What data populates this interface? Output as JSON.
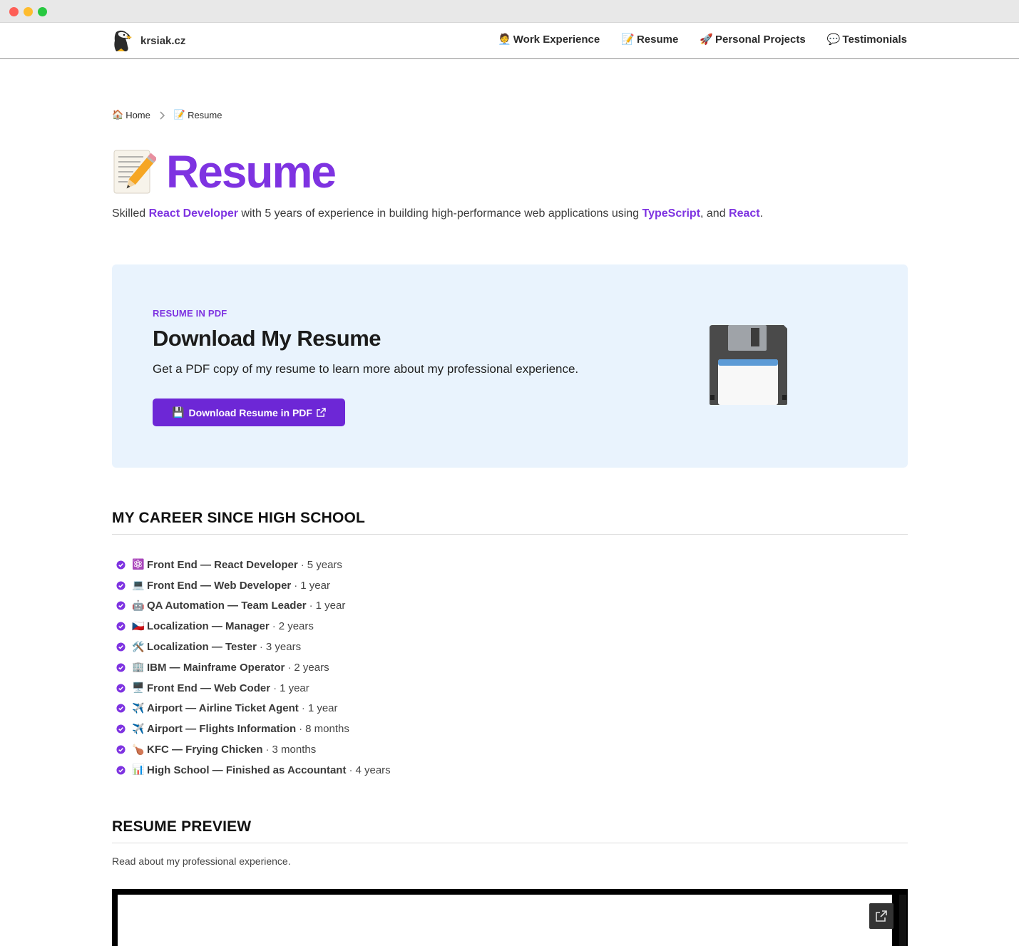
{
  "site": {
    "name": "krsiak.cz"
  },
  "nav": {
    "items": [
      {
        "icon": "🧑‍💼",
        "label": "Work Experience"
      },
      {
        "icon": "📝",
        "label": "Resume"
      },
      {
        "icon": "🚀",
        "label": "Personal Projects"
      },
      {
        "icon": "💬",
        "label": "Testimonials"
      }
    ]
  },
  "breadcrumb": {
    "home_icon": "🏠",
    "home": "Home",
    "current_icon": "📝",
    "current": "Resume"
  },
  "hero": {
    "emoji": "📝",
    "title": "Resume",
    "intro_prefix": "Skilled ",
    "intro_role": "React Developer",
    "intro_middle": " with 5 years of experience in building high-performance web applications using ",
    "intro_tech1": "TypeScript",
    "intro_between": ", and ",
    "intro_tech2": "React",
    "intro_suffix": "."
  },
  "cta": {
    "eyebrow": "RESUME IN PDF",
    "title": "Download My Resume",
    "description": "Get a PDF copy of my resume to learn more about my professional experience.",
    "button_icon": "💾",
    "button_label": "Download Resume in PDF"
  },
  "career": {
    "title": "MY CAREER SINCE HIGH SCHOOL",
    "items": [
      {
        "icon": "⚛️",
        "role": "Front End — React Developer",
        "duration": "5 years"
      },
      {
        "icon": "💻",
        "role": "Front End — Web Developer",
        "duration": "1 year"
      },
      {
        "icon": "🤖",
        "role": "QA Automation — Team Leader",
        "duration": "1 year"
      },
      {
        "icon": "🇨🇿",
        "role": "Localization — Manager",
        "duration": "2 years"
      },
      {
        "icon": "🛠️",
        "role": "Localization — Tester",
        "duration": "3 years"
      },
      {
        "icon": "🏢",
        "role": "IBM — Mainframe Operator",
        "duration": "2 years"
      },
      {
        "icon": "🖥️",
        "role": "Front End — Web Coder",
        "duration": "1 year"
      },
      {
        "icon": "✈️",
        "role": "Airport — Airline Ticket Agent",
        "duration": "1 year"
      },
      {
        "icon": "✈️",
        "role": "Airport — Flights Information",
        "duration": "8 months"
      },
      {
        "icon": "🍗",
        "role": "KFC — Frying Chicken",
        "duration": "3 months"
      },
      {
        "icon": "📊",
        "role": "High School — Finished as Accountant",
        "duration": "4 years"
      }
    ]
  },
  "preview": {
    "title": "RESUME PREVIEW",
    "description": "Read about my professional experience."
  },
  "colors": {
    "accent": "#7e33e1",
    "button": "#6d27d6",
    "card_bg": "#e9f3fd"
  }
}
